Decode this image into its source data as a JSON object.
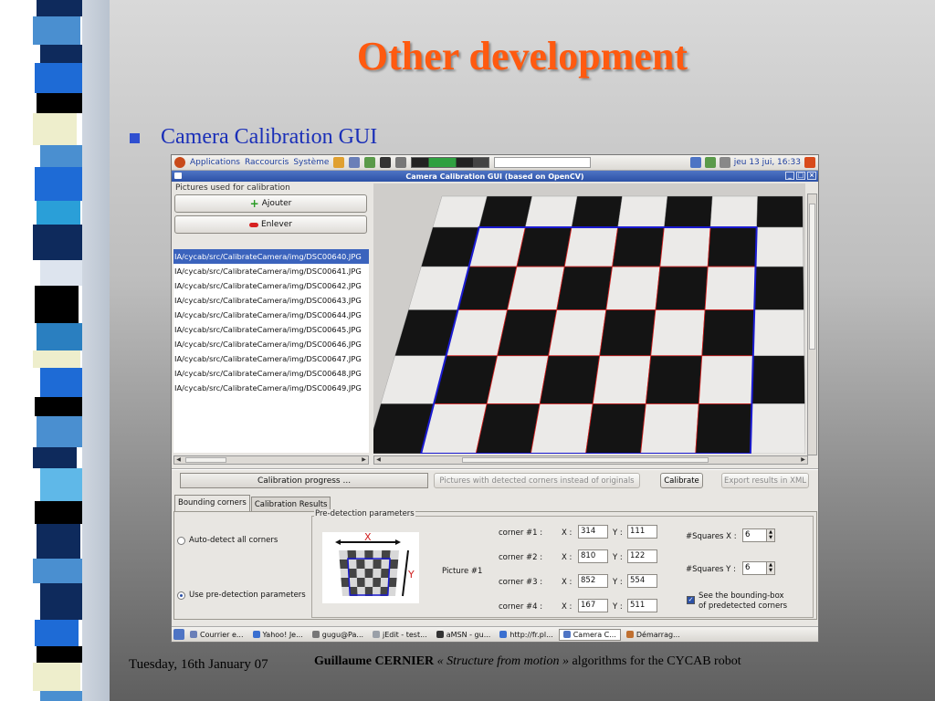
{
  "slide": {
    "title": "Other development",
    "bullet": "Camera Calibration GUI",
    "footer_date": "Tuesday, 16th January 07",
    "footer_author": "Guillaume CERNIER",
    "footer_work": "« Structure from motion »",
    "footer_rest": "algorithms for the CYCAB robot"
  },
  "colors": {
    "title": "#ff5a10",
    "bullet": "#1a2fb8",
    "selection": "#3b63bd",
    "corner_box": "#1a1ad0",
    "corner_lines": "#d02020"
  },
  "panel_bar": {
    "applications": "Applications",
    "raccourcis": "Raccourcis",
    "systeme": "Système",
    "clock": "jeu 13 jui, 16:33"
  },
  "window": {
    "title": "Camera Calibration GUI (based on OpenCV)"
  },
  "pictures": {
    "group_label": "Pictures used for calibration",
    "add_label": "Ajouter",
    "remove_label": "Enlever",
    "files": [
      "IA/cycab/src/CalibrateCamera/img/DSC00640.JPG",
      "IA/cycab/src/CalibrateCamera/img/DSC00641.JPG",
      "IA/cycab/src/CalibrateCamera/img/DSC00642.JPG",
      "IA/cycab/src/CalibrateCamera/img/DSC00643.JPG",
      "IA/cycab/src/CalibrateCamera/img/DSC00644.JPG",
      "IA/cycab/src/CalibrateCamera/img/DSC00645.JPG",
      "IA/cycab/src/CalibrateCamera/img/DSC00646.JPG",
      "IA/cycab/src/CalibrateCamera/img/DSC00647.JPG",
      "IA/cycab/src/CalibrateCamera/img/DSC00648.JPG",
      "IA/cycab/src/CalibrateCamera/img/DSC00649.JPG"
    ],
    "selected_index": 0
  },
  "toolbar": {
    "progress_label": "Calibration progress ...",
    "toggle_label": "Pictures with detected corners instead of originals",
    "calibrate_label": "Calibrate",
    "export_label": "Export results in XML"
  },
  "tabs": [
    "Bounding corners",
    "Calibration Results"
  ],
  "predetection": {
    "group_label": "Pre-detection parameters",
    "auto_detect_label": "Auto-detect all corners",
    "use_params_label": "Use pre-detection parameters",
    "picture_label": "Picture #1",
    "diagram_x": "X",
    "diagram_y": "Y",
    "corners": [
      {
        "label": "corner #1 :",
        "x": "314",
        "y": "111"
      },
      {
        "label": "corner #2 :",
        "x": "810",
        "y": "122"
      },
      {
        "label": "corner #3 :",
        "x": "852",
        "y": "554"
      },
      {
        "label": "corner #4 :",
        "x": "167",
        "y": "511"
      }
    ],
    "x_prefix": "X :",
    "y_prefix": "Y :",
    "squares_x_label": "#Squares X :",
    "squares_x": "6",
    "squares_y_label": "#Squares Y :",
    "squares_y": "6",
    "see_bbox_line1": "See the bounding-box",
    "see_bbox_line2": "of predetected corners"
  },
  "taskbar": [
    "Courrier e...",
    "Yahoo! Je...",
    "gugu@Pa...",
    "jEdit - test...",
    "aMSN - gu...",
    "http://fr.pl...",
    "Camera C...",
    "Démarrag..."
  ]
}
